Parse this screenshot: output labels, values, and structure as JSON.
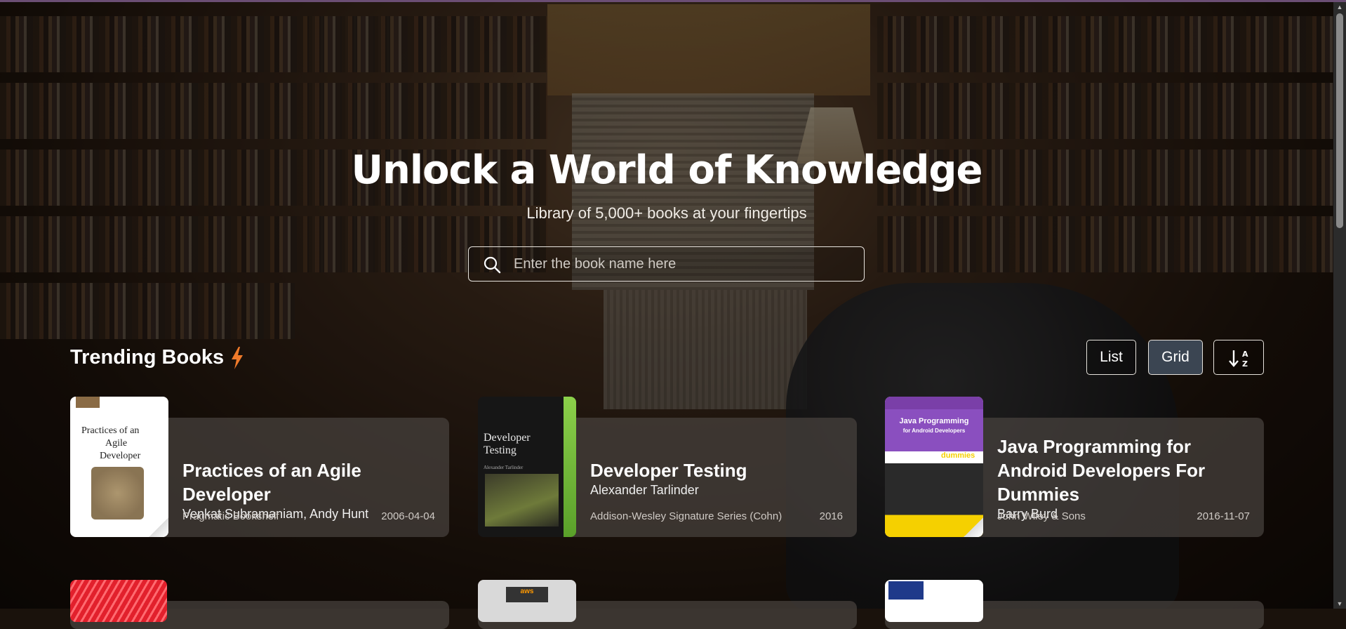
{
  "hero": {
    "title": "Unlock a World of Knowledge",
    "subtitle": "Library of 5,000+ books at your fingertips",
    "search_placeholder": "Enter the book name here"
  },
  "section": {
    "title": "Trending Books",
    "view_list_label": "List",
    "view_grid_label": "Grid",
    "active_view": "Grid",
    "accent_color": "#f07a2a"
  },
  "books": [
    {
      "title": "Practices of an Agile Developer",
      "authors": "Venkat Subramaniam, Andy Hunt",
      "publisher": "Pragmatic Bookshelf",
      "date": "2006-04-04",
      "cover_text_1": "Practices of an",
      "cover_text_2": "Agile",
      "cover_text_3": "Developer"
    },
    {
      "title": "Developer Testing",
      "authors": "Alexander Tarlinder",
      "publisher": "Addison-Wesley Signature Series (Cohn)",
      "date": "2016",
      "cover_text_1": "Developer",
      "cover_text_2": "Testing",
      "cover_text_3": "Alexander Tarlinder"
    },
    {
      "title": "Java Programming for Android Developers For Dummies",
      "authors": "Barry Burd",
      "publisher": "John Wiley & Sons",
      "date": "2016-11-07",
      "cover_text_1": "Java Programming",
      "cover_text_2": "for Android Developers",
      "cover_text_3": "dummies"
    }
  ],
  "next_row_covers": [
    {
      "cover_text": ""
    },
    {
      "cover_text": "aws"
    },
    {
      "cover_text": ""
    }
  ]
}
